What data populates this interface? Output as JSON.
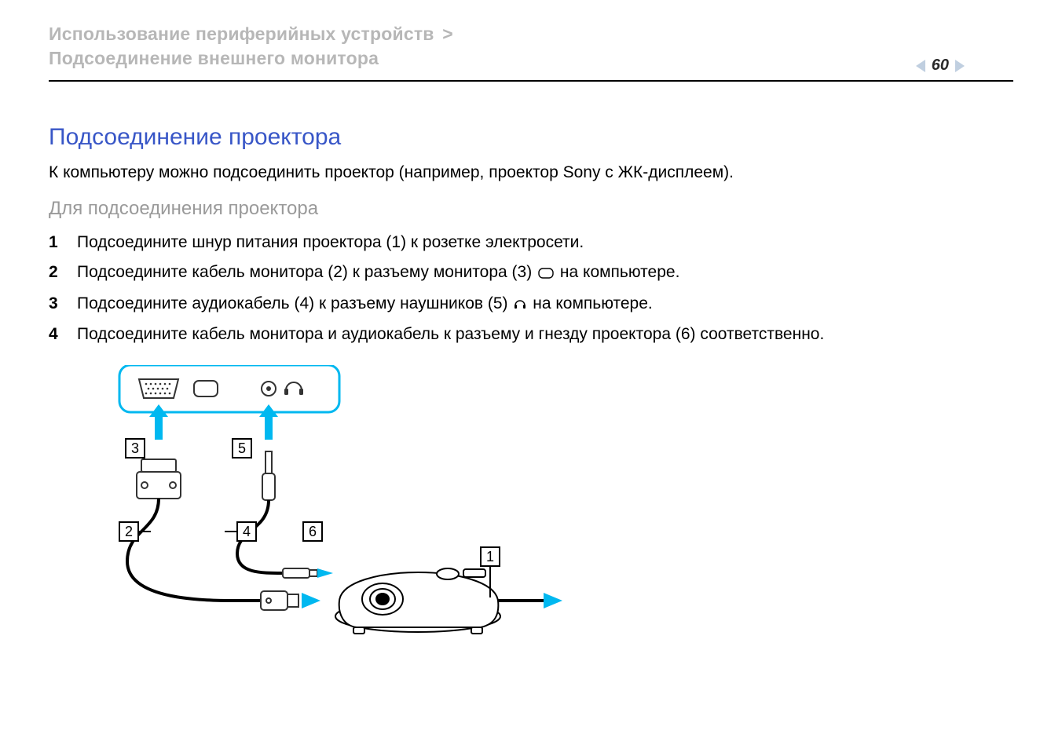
{
  "header": {
    "breadcrumb_parent": "Использование периферийных устройств",
    "breadcrumb_sep": ">",
    "breadcrumb_child": "Подсоединение внешнего монитора",
    "page_number": "60"
  },
  "section": {
    "title": "Подсоединение проектора",
    "intro": "К компьютеру можно подсоединить проектор (например, проектор Sony с ЖК-дисплеем).",
    "subtitle": "Для подсоединения проектора"
  },
  "steps": [
    {
      "pre": "Подсоедините шнур питания проектора (1) к розетке электросети.",
      "icon": null,
      "post": ""
    },
    {
      "pre": "Подсоедините кабель монитора (2) к разъему монитора (3) ",
      "icon": "monitor-port-icon",
      "post": " на компьютере."
    },
    {
      "pre": "Подсоедините аудиокабель (4) к разъему наушников (5) ",
      "icon": "headphones-icon",
      "post": " на компьютере."
    },
    {
      "pre": "Подсоедините кабель монитора и аудиокабель к разъему и гнезду проектора (6) соответственно.",
      "icon": null,
      "post": ""
    }
  ],
  "diagram_labels": {
    "l1": "1",
    "l2": "2",
    "l3": "3",
    "l4": "4",
    "l5": "5",
    "l6": "6"
  }
}
